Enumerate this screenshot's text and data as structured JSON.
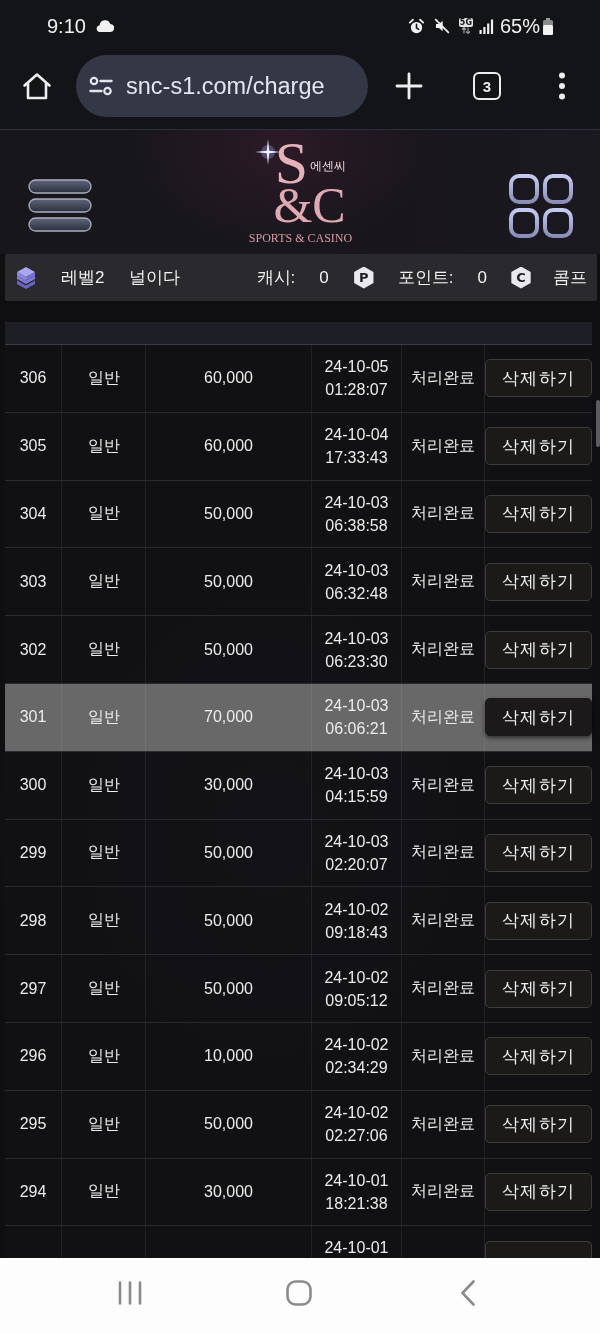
{
  "status_bar": {
    "time": "9:10",
    "network": "5G",
    "battery": "65%"
  },
  "browser": {
    "url": "snc-s1.com/charge",
    "tab_count": "3"
  },
  "header": {
    "logo": {
      "monogram": [
        "S",
        "&C"
      ],
      "korean_name": "에센씨",
      "tagline": "SPORTS & CASINO"
    }
  },
  "info_bar": {
    "member_grade": "레벨2",
    "username": "널이다",
    "cash_label": "캐시:",
    "cash_value": "0",
    "points_badge": "P",
    "points_label": "포인트:",
    "points_value": "0",
    "comp_badge": "C",
    "comp_label": "콤프"
  },
  "table": {
    "rows": [
      {
        "kind": "full",
        "no": "306",
        "type": "일반",
        "amount": "60,000",
        "date": "24-10-05",
        "time": "01:28:07",
        "status": "처리완료",
        "action": "삭제하기",
        "selected": false
      },
      {
        "kind": "full",
        "no": "305",
        "type": "일반",
        "amount": "60,000",
        "date": "24-10-04",
        "time": "17:33:43",
        "status": "처리완료",
        "action": "삭제하기",
        "selected": false
      },
      {
        "kind": "full",
        "no": "304",
        "type": "일반",
        "amount": "50,000",
        "date": "24-10-03",
        "time": "06:38:58",
        "status": "처리완료",
        "action": "삭제하기",
        "selected": false
      },
      {
        "kind": "full",
        "no": "303",
        "type": "일반",
        "amount": "50,000",
        "date": "24-10-03",
        "time": "06:32:48",
        "status": "처리완료",
        "action": "삭제하기",
        "selected": false
      },
      {
        "kind": "full",
        "no": "302",
        "type": "일반",
        "amount": "50,000",
        "date": "24-10-03",
        "time": "06:23:30",
        "status": "처리완료",
        "action": "삭제하기",
        "selected": false
      },
      {
        "kind": "full",
        "no": "301",
        "type": "일반",
        "amount": "70,000",
        "date": "24-10-03",
        "time": "06:06:21",
        "status": "처리완료",
        "action": "삭제하기",
        "selected": true
      },
      {
        "kind": "full",
        "no": "300",
        "type": "일반",
        "amount": "30,000",
        "date": "24-10-03",
        "time": "04:15:59",
        "status": "처리완료",
        "action": "삭제하기",
        "selected": false
      },
      {
        "kind": "full",
        "no": "299",
        "type": "일반",
        "amount": "50,000",
        "date": "24-10-03",
        "time": "02:20:07",
        "status": "처리완료",
        "action": "삭제하기",
        "selected": false
      },
      {
        "kind": "full",
        "no": "298",
        "type": "일반",
        "amount": "50,000",
        "date": "24-10-02",
        "time": "09:18:43",
        "status": "처리완료",
        "action": "삭제하기",
        "selected": false
      },
      {
        "kind": "full",
        "no": "297",
        "type": "일반",
        "amount": "50,000",
        "date": "24-10-02",
        "time": "09:05:12",
        "status": "처리완료",
        "action": "삭제하기",
        "selected": false
      },
      {
        "kind": "full",
        "no": "296",
        "type": "일반",
        "amount": "10,000",
        "date": "24-10-02",
        "time": "02:34:29",
        "status": "처리완료",
        "action": "삭제하기",
        "selected": false
      },
      {
        "kind": "full",
        "no": "295",
        "type": "일반",
        "amount": "50,000",
        "date": "24-10-02",
        "time": "02:27:06",
        "status": "처리완료",
        "action": "삭제하기",
        "selected": false
      },
      {
        "kind": "full",
        "no": "294",
        "type": "일반",
        "amount": "30,000",
        "date": "24-10-01",
        "time": "18:21:38",
        "status": "처리완료",
        "action": "삭제하기",
        "selected": false
      },
      {
        "kind": "cut",
        "date": "24-10-01",
        "selected": false
      }
    ]
  }
}
